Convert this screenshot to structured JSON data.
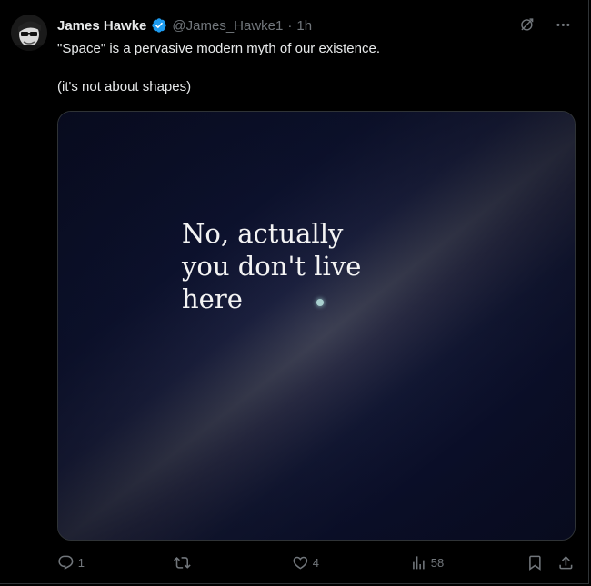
{
  "author": {
    "name": "James Hawke",
    "handle": "@James_Hawke1",
    "separator": "·",
    "time": "1h",
    "verified_color": "#1d9bf0"
  },
  "tweet": {
    "line1": "\"Space\" is a pervasive modern myth of our existence.",
    "line2": "(it's not about shapes)"
  },
  "media": {
    "overlay_text_line1": "No, actually",
    "overlay_text_line2": "you don't live",
    "overlay_text_line3": "here"
  },
  "actions": {
    "reply_count": "1",
    "retweet_count": "",
    "like_count": "4",
    "views_count": "58"
  },
  "icons": [
    "grok-icon",
    "more-icon",
    "reply-icon",
    "retweet-icon",
    "like-icon",
    "views-icon",
    "bookmark-icon",
    "share-icon"
  ]
}
